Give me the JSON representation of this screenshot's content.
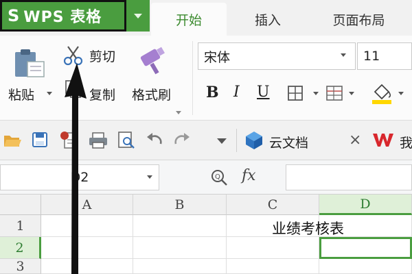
{
  "app": {
    "logo": "S",
    "title": "WPS 表格"
  },
  "tabs": {
    "home": "开始",
    "insert": "插入",
    "layout": "页面布局"
  },
  "ribbon": {
    "paste": "粘贴",
    "cut": "剪切",
    "copy": "复制",
    "format_painter": "格式刷",
    "font_name": "宋体",
    "font_size": "11",
    "bold": "B",
    "italic": "I",
    "underline": "U"
  },
  "quick_access": {
    "cloud_docs": "云文档",
    "close": "×",
    "wps_tab_partial": "我"
  },
  "formula_bar": {
    "name_box": "D2",
    "fx": "fx"
  },
  "grid": {
    "columns": [
      "A",
      "B",
      "C",
      "D"
    ],
    "rows": [
      "1",
      "2",
      "3"
    ],
    "cell_c1": "业绩考核表"
  },
  "colors": {
    "accent": "#4a9d3f",
    "annotation": "#111111"
  }
}
